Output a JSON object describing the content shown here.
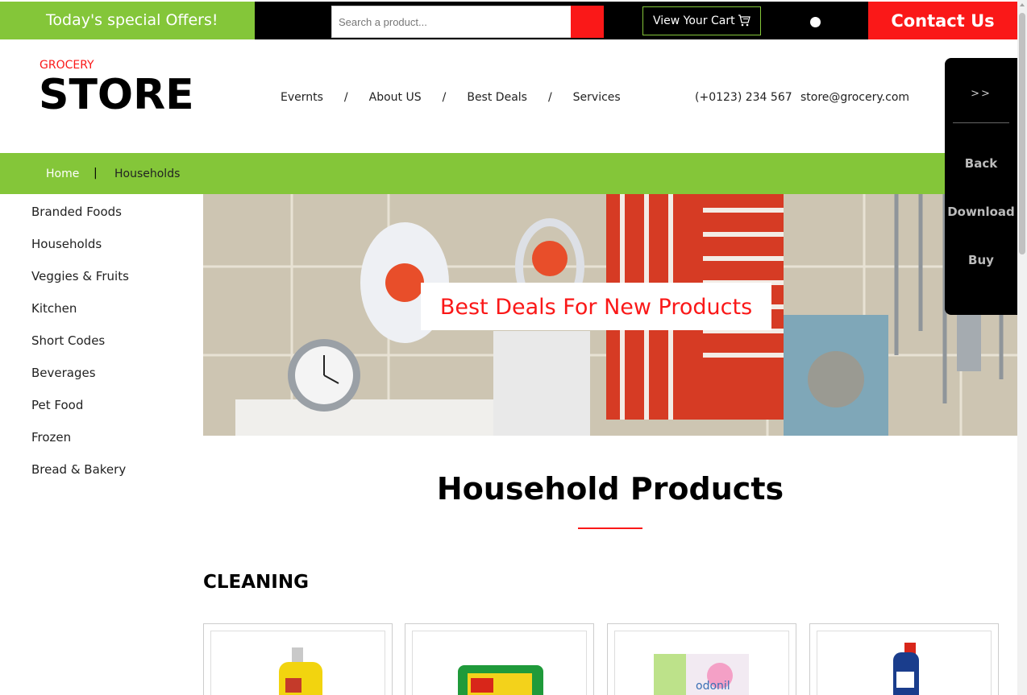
{
  "topbar": {
    "offers_label": "Today's special Offers!",
    "search_placeholder": "Search a product...",
    "cart_label": "View Your Cart",
    "contact_label": "Contact Us"
  },
  "header": {
    "logo_small": "GROCERY",
    "logo_big": "STORE",
    "nav": [
      "Evernts",
      "About US",
      "Best Deals",
      "Services"
    ],
    "phone": "(+0123) 234 567",
    "email": "store@grocery.com"
  },
  "side_panel": {
    "toggle": ">>",
    "items": [
      "Back",
      "Download",
      "Buy"
    ]
  },
  "breadcrumb": {
    "home": "Home",
    "separator": "|",
    "current": "Households"
  },
  "left_menu": [
    "Branded Foods",
    "Households",
    "Veggies & Fruits",
    "Kitchen",
    "Short Codes",
    "Beverages",
    "Pet Food",
    "Frozen",
    "Bread & Bakery"
  ],
  "banner": {
    "caption": "Best Deals For New Products"
  },
  "main": {
    "section_title": "Household Products",
    "category_title": "CLEANING"
  },
  "colors": {
    "green": "#84c639",
    "red": "#fa1818",
    "black": "#000000"
  }
}
